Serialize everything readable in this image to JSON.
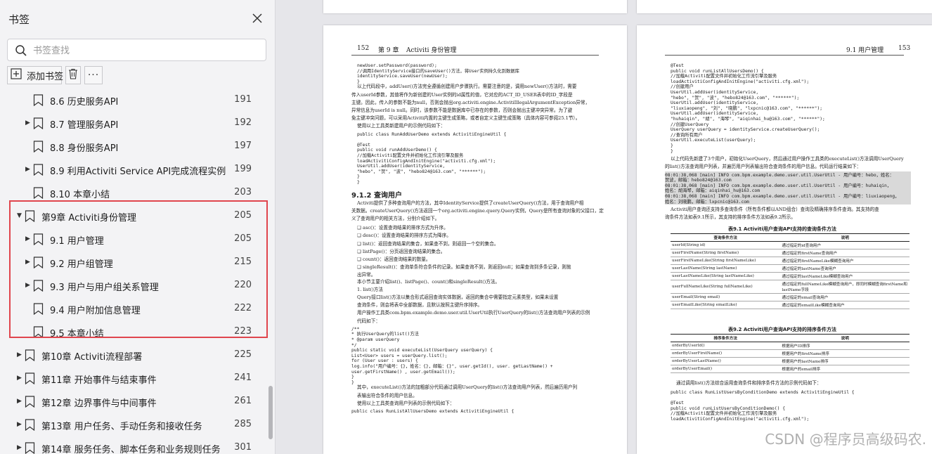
{
  "sidebar": {
    "title": "书签",
    "search_placeholder": "书签查找",
    "add_bookmark_label": "添加书签",
    "more_label": "···",
    "items": [
      {
        "label": "8.6 历史服务API",
        "page": "191",
        "level": 2,
        "expandable": false
      },
      {
        "label": "8.7 管理服务API",
        "page": "192",
        "level": 2,
        "expandable": true
      },
      {
        "label": "8.8 身份服务API",
        "page": "197",
        "level": 2,
        "expandable": false
      },
      {
        "label": "8.9 利用Activiti Service API完成流程实例",
        "page": "199",
        "level": 2,
        "expandable": true
      },
      {
        "label": "8.10 本章小结",
        "page": "203",
        "level": 2,
        "expandable": false
      },
      {
        "label": "第9章 Activiti身份管理",
        "page": "205",
        "level": 1,
        "expandable": true,
        "expanded": true
      },
      {
        "label": "9.1 用户管理",
        "page": "205",
        "level": 2,
        "expandable": true
      },
      {
        "label": "9.2 用户组管理",
        "page": "215",
        "level": 2,
        "expandable": true
      },
      {
        "label": "9.3 用户与用户组关系管理",
        "page": "220",
        "level": 2,
        "expandable": true
      },
      {
        "label": "9.4 用户附加信息管理",
        "page": "222",
        "level": 2,
        "expandable": false
      },
      {
        "label": "9.5 本章小结",
        "page": "223",
        "level": 2,
        "expandable": false
      },
      {
        "label": "第10章 Activiti流程部署",
        "page": "225",
        "level": 1,
        "expandable": true
      },
      {
        "label": "第11章 开始事件与结束事件",
        "page": "241",
        "level": 1,
        "expandable": true
      },
      {
        "label": "第12章 边界事件与中间事件",
        "page": "261",
        "level": 1,
        "expandable": true
      },
      {
        "label": "第13章 用户任务、手动任务和接收任务",
        "page": "285",
        "level": 1,
        "expandable": true
      },
      {
        "label": "第14章 服务任务、脚本任务和业务规则任务",
        "page": "301",
        "level": 1,
        "expandable": true
      }
    ]
  },
  "left_page": {
    "page_number": "152",
    "chapter": "第 9 章",
    "chapter_title": "Activiti 身份管理",
    "section_title": "9.1.2 查询用户",
    "lines_top": [
      {
        "t": "newUser.setPassword(password);",
        "code": true
      },
      {
        "t": "//调用IdentityService接口的saveUser()方法，将User实例持久化到数据库",
        "code": true
      },
      {
        "t": "identityService.saveUser(newUser);",
        "code": true
      },
      {
        "t": "}",
        "code": true
      },
      {
        "t": "以上代码段中，addUser()方法完全遵循创建用户步骤执行。需要注意的是，调用newUser()方法时，需要",
        "code": false
      },
      {
        "t": "传入userId参数，其值将作为新创建的User实例的id属性的值，它对应的ACT_ID_USER表中的ID_字段是",
        "code": false
      },
      {
        "t": "主键。因此，传入的参数不能为null，否则会抛出org.activiti.engine.ActivitiIllegalArgumentException异常，",
        "code": false
      },
      {
        "t": "异常信息为userId is null。同时，该参数不能是数据库中已存在的参数，否则会抛出主键冲突异常。为了避",
        "code": false
      },
      {
        "t": "免主键冲突问题，可以采用Activiti内置的主键生成策略，或者自定义主键生成策略（具体内容可参阅25.1节）。",
        "code": false
      },
      {
        "t": "使用以上工具类新建用户的示例代码如下：",
        "code": false
      },
      {
        "t": "public class RunAddUserDemo extends ActivitiEngineUtil {",
        "code": true
      },
      {
        "t": "",
        "code": true
      },
      {
        "t": "@Test",
        "code": true
      },
      {
        "t": "public void runAddUserDemo() {",
        "code": true
      },
      {
        "t": "    //加载Activiti配置文件并初始化工作流引擎及服务",
        "code": true
      },
      {
        "t": "    loadActivitiConfigAndInitEngine(\"activiti.cfg.xml\");",
        "code": true
      },
      {
        "t": "    UserUtil.addUser(identityService,",
        "code": true
      },
      {
        "t": "        \"hebo\", \"贺\", \"波\", \"hebo824@163.com\", \"******\");",
        "code": true
      },
      {
        "t": "}",
        "code": true
      },
      {
        "t": "}",
        "code": true
      }
    ],
    "lines_mid": [
      "Activiti提供了多种查询用户的方法，其中IdentityService提供了createUserQuery()方法，用于查询用户相",
      "关数据。createUserQuery()方法返回一个org.activiti.engine.query.Query实例，Query是所有查询对象的父接口，定",
      "义了查询用户的相关方法，分别介绍如下。"
    ],
    "bullets": [
      "asc()：设置查询结果的排序方式为升序。",
      "desc()：设置查询结果的排序方式为降序。",
      "list()：返回查询结果的集合，如果查不到，则返回一个空的集合。",
      "listPage()：分页返回查询结果的集合。",
      "count()：返回查询结果的数量。",
      "singleResult()：查询单条符合条件的记录。如果查询不到，则返回null；如果查询到多条记录，则抛",
      "    出异常。"
    ],
    "lines_bottom": [
      {
        "t": "本小节主要介绍list()、listPage()、count()和singleResult()方法。",
        "code": false
      },
      {
        "t": "1. list()方法",
        "code": false
      },
      {
        "t": "Query接口list()方法以集合形式返回查询实体数据，返回的集合中需要指定元素类型，如果未设置",
        "code": false
      },
      {
        "t": "查询条件，则会将表中全部数据，且默认按照主键升序排序。",
        "code": false
      },
      {
        "t": "用户操作工具类com.bpm.example.demo.user.util.UserUtil执行UserQuery的list()方法查询用户列表的示例",
        "code": false
      },
      {
        "t": "代码如下：",
        "code": false
      },
      {
        "t": "/**",
        "code": true
      },
      {
        "t": " * 执行UserQuery的list()方法",
        "code": true
      },
      {
        "t": " * @param userQuery",
        "code": true
      },
      {
        "t": " */",
        "code": true
      },
      {
        "t": "public static void executeList(UserQuery userQuery) {",
        "code": true
      },
      {
        "t": "    List<User> users = userQuery.list();",
        "code": true
      },
      {
        "t": "    for (User user : users) {",
        "code": true
      },
      {
        "t": "        log.info(\"用户编号：{}，姓名：{}，邮箱：{}\", user.getId(), user. getLastName() +",
        "code": true
      },
      {
        "t": "            user.getFirstName() , user.getEmail());",
        "code": true
      },
      {
        "t": "    }",
        "code": true
      },
      {
        "t": "}",
        "code": true
      },
      {
        "t": "其中，executeList()方法的加粗部分代码通过调用UserQuery的list()方法查询用户列表，然后遍历用户列",
        "code": false
      },
      {
        "t": "表输出符合条件的用户信息。",
        "code": false
      },
      {
        "t": "使用以上工具类查询用户列表的示例代码如下：",
        "code": false
      },
      {
        "t": "public class RunListAllUsersDemo extends ActivitiEngineUtil {",
        "code": true
      }
    ]
  },
  "right_page": {
    "page_number": "153",
    "header_title": "9.1 用户管理",
    "lines_top": [
      "@Test",
      "public void runListAllUsersDemo() {",
      "    //加载Activiti配置文件并初始化工作流引擎及服务",
      "    loadActivitiConfigAndInitEngine(\"activiti.cfg.xml\");",
      "    //创建用户",
      "    UserUtil.addUser(identityService,",
      "        \"hebo\", \"贺\", \"波\", \"hebo824@163.com\", \"******\");",
      "    UserUtil.addUser(identityService,",
      "        \"liuxiaopeng\", \"刘\", \"晓鹏\", \"lxpcnic@163.com\", \"******\");",
      "    UserUtil.addUser(identityService,",
      "        \"huhaiqin\", \"胡\", \"海琴\", \"aiqinhai_hu@163.com\", \"******\");",
      "    //创建UserQuery",
      "    UserQuery userQuery = identityService.createUserQuery();",
      "    //查询所有用户",
      "    UserUtil.executeList(userQuery);",
      "}",
      "}"
    ],
    "lines_mid1": [
      "以上代码先新建了3个用户，初始化UserQuery，然后通过用户操作工具类的executeList()方法调用UserQuery",
      "的list()方法查询用户列表，并遍历用户列表输出符合查询条件的用户信息。代码运行结果如下："
    ],
    "log_lines": [
      "08:01:38,068 [main] INFO  com.bpm.example.demo.user.util.UserUtil  - 用户编号：hebo，姓名：",
      "贺波，邮箱：hebo824@163.com",
      "08:01:38,068 [main] INFO  com.bpm.example.demo.user.util.UserUtil  - 用户编号：huhaiqin，",
      "姓名：胡海琴，邮箱：aiqinhai_hu@163.com",
      "08:01:38,068 [main] INFO  com.bpm.example.demo.user.util.UserUtil  - 用户编号：liuxiaopeng，",
      "姓名：刘晓鹏，邮箱：lxpcnic@163.com"
    ],
    "lines_mid2": [
      "Activiti用户查询还支持多查询条件（所有条件都以AND组合）查询及精确排序条件查询。其支持的查",
      "询条件方法如表9.1所示，其支持的排序条件方法如表9.2所示。"
    ],
    "table1": {
      "title": "表9.1  Activiti用户查询API支持的查询条件方法",
      "headers": [
        "查询条件方法",
        "说明"
      ],
      "rows": [
        [
          "userId(String id)",
          "通过指定的id查询用户"
        ],
        [
          "userFirstName(String firstName)",
          "通过指定的firstName查询用户"
        ],
        [
          "userFirstNameLike(String firstNameLike)",
          "通过指定的firstNameLike模糊查询用户"
        ],
        [
          "userLastName(String lastName)",
          "通过指定的lastName查询用户"
        ],
        [
          "userLastNameLike(String lastNameLike)",
          "通过指定的lastNameLike模糊查询用户"
        ],
        [
          "userFullNameLike(String fullNameLike)",
          "通过指定的fullNameLike模糊查询用户，即同时模糊查询firstName和lastName字段"
        ],
        [
          "userEmail(String email)",
          "通过指定的email查询用户"
        ],
        [
          "userEmailLike(String emailLike)",
          "通过指定的emailLike模糊查询用户"
        ]
      ]
    },
    "table2": {
      "title": "表9.2  Activiti用户查询API支持的排序条件方法",
      "headers": [
        "排序条件方法",
        "说明"
      ],
      "rows": [
        [
          "orderByUserId()",
          "根据用户ID排序"
        ],
        [
          "orderByUserFirstName()",
          "根据用户的firstName排序"
        ],
        [
          "orderByUserLastName()",
          "根据用户的lastName排序"
        ],
        [
          "orderByUserEmail()",
          "根据用户的email排序"
        ]
      ]
    },
    "lines_bottom": [
      {
        "t": "通过调用list()方法综合运用查询条件和排序条件方法的示例代码如下：",
        "code": false
      },
      {
        "t": "public class RunListUsersByConditionDemo extends ActivitiEngineUtil {",
        "code": true
      },
      {
        "t": "",
        "code": true
      },
      {
        "t": "@Test",
        "code": true
      },
      {
        "t": "public void runListUsersByConditionDemo() {",
        "code": true
      },
      {
        "t": "    //加载Activiti配置文件并初始化工作流引擎及服务",
        "code": true
      },
      {
        "t": "    loadActivitiConfigAndInitEngine(\"activiti.cfg.xml\");",
        "code": true
      }
    ]
  },
  "watermark": "CSDN @程序员高级码农."
}
